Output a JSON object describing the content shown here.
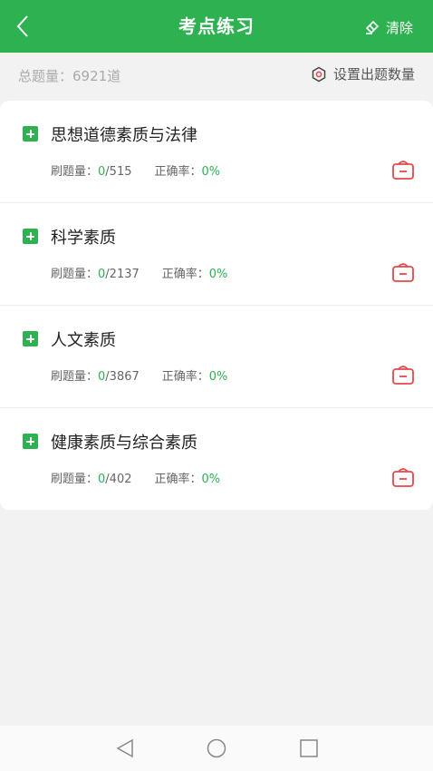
{
  "header": {
    "title": "考点练习",
    "clear_label": "清除"
  },
  "summary": {
    "total_label": "总题量：",
    "total_value": "6921道",
    "settings_label": "设置出题数量"
  },
  "items": [
    {
      "title": "思想道德素质与法律",
      "done_label": "刷题量：",
      "done": "0",
      "total": "/515",
      "rate_label": "正确率：",
      "rate": "0%"
    },
    {
      "title": "科学素质",
      "done_label": "刷题量：",
      "done": "0",
      "total": "/2137",
      "rate_label": "正确率：",
      "rate": "0%"
    },
    {
      "title": "人文素质",
      "done_label": "刷题量：",
      "done": "0",
      "total": "/3867",
      "rate_label": "正确率：",
      "rate": "0%"
    },
    {
      "title": "健康素质与综合素质",
      "done_label": "刷题量：",
      "done": "0",
      "total": "/402",
      "rate_label": "正确率：",
      "rate": "0%"
    }
  ],
  "colors": {
    "accent": "#2eb150",
    "bag": "#e5484d"
  }
}
